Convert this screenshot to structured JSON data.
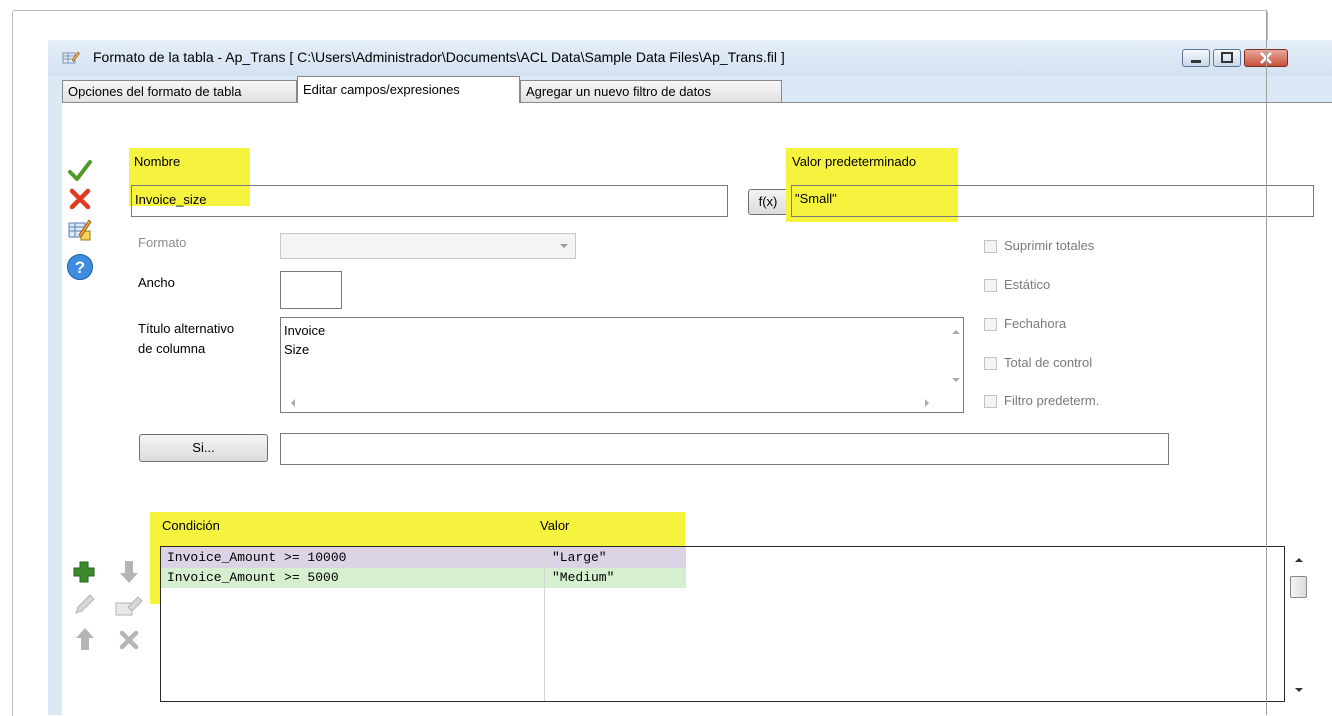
{
  "window": {
    "title": "Formato de la tabla - Ap_Trans [ C:\\Users\\Administrador\\Documents\\ACL Data\\Sample Data Files\\Ap_Trans.fil ]"
  },
  "tabs": [
    {
      "label": "Opciones del formato de tabla"
    },
    {
      "label": "Editar campos/expresiones"
    },
    {
      "label": "Agregar un nuevo filtro de datos"
    }
  ],
  "form": {
    "nombre_label": "Nombre",
    "nombre_value": "Invoice_size",
    "fx_label": "f(x)",
    "default_label": "Valor predeterminado",
    "default_value": "\"Small\"",
    "formato_label": "Formato",
    "ancho_label": "Ancho",
    "alt_title_label_1": "Título alternativo",
    "alt_title_label_2": "de columna",
    "alt_title_line_1": "Invoice",
    "alt_title_line_2": "Size",
    "si_button": "Si...",
    "checkboxes": [
      {
        "label": "Suprimir totales"
      },
      {
        "label": "Estático"
      },
      {
        "label": "Fechahora"
      },
      {
        "label": "Total de control"
      },
      {
        "label": "Filtro predeterm."
      }
    ]
  },
  "conditions": {
    "col_condition": "Condición",
    "col_value": "Valor",
    "rows": [
      {
        "condition": "Invoice_Amount >= 10000",
        "value": "\"Large\"",
        "color": "#dcd3e6"
      },
      {
        "condition": "Invoice_Amount >= 5000",
        "value": "\"Medium\"",
        "color": "#d6f0cf"
      }
    ]
  },
  "colors": {
    "highlight": "#f6f33f",
    "window_bg": "#dbe8f6",
    "accept_green": "#4f9a2a",
    "cancel_red": "#e0391f"
  }
}
